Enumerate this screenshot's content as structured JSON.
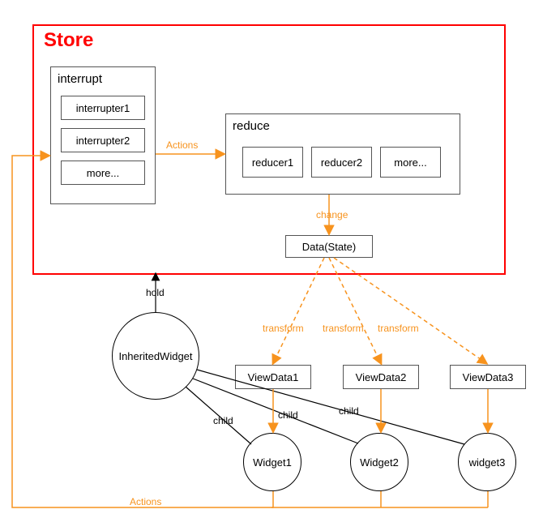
{
  "store": {
    "title": "Store"
  },
  "interrupt": {
    "title": "interrupt",
    "items": [
      "interrupter1",
      "interrupter2",
      "more..."
    ]
  },
  "reduce": {
    "title": "reduce",
    "items": [
      "reducer1",
      "reducer2",
      "more..."
    ]
  },
  "dataState": "Data(State)",
  "inherited": "InheritedWidget",
  "viewData": [
    "ViewData1",
    "ViewData2",
    "ViewData3"
  ],
  "widgets": [
    "Widget1",
    "Widget2",
    "widget3"
  ],
  "labels": {
    "actions1": "Actions",
    "change": "change",
    "transform1": "transform",
    "transform2": "transform",
    "transform3": "transform",
    "hold": "hold",
    "child1": "child",
    "child2": "child",
    "child3": "child",
    "actions2": "Actions"
  },
  "colors": {
    "accent": "#f7931e",
    "store": "#ff0000",
    "line": "#000000"
  }
}
